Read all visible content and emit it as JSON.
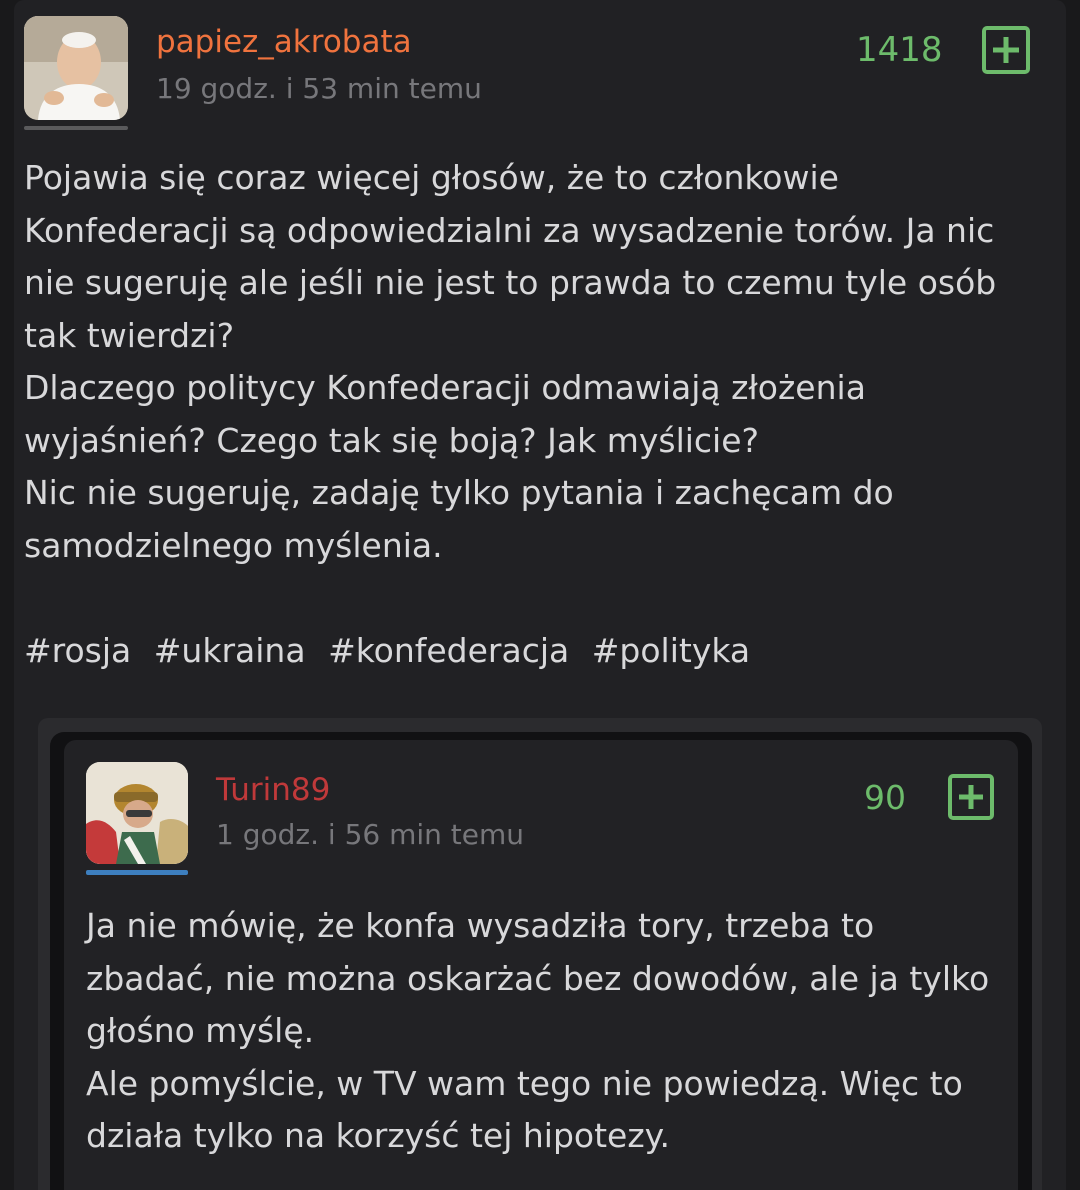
{
  "post": {
    "username": "papiez_akrobata",
    "time": "19 godz. i 53 min temu",
    "votes": "1418",
    "plus_icon": "plus-square-icon",
    "body_lines": [
      "Pojawia się coraz więcej głosów, że to członkowie Konfederacji są odpowiedzialni za wysadzenie torów. Ja nic nie sugeruję ale jeśli nie jest to prawda to czemu tyle osób tak twierdzi?",
      "Dlaczego politycy Konfederacji odmawiają złożenia wyjaśnień? Czego tak się boją? Jak myślicie?",
      "Nic nie sugeruję, zadaję tylko pytania i zachęcam do samodzielnego myślenia."
    ],
    "tags": [
      "#rosja",
      "#ukraina",
      "#konfederacja",
      "#polityka"
    ]
  },
  "reply": {
    "username": "Turin89",
    "time": "1 godz. i 56 min temu",
    "votes": "90",
    "body_lines": [
      "Ja nie mówię, że konfa wysadziła tory, trzeba to zbadać, nie można oskarżać bez dowodów, ale ja tylko głośno myślę.",
      "Ale pomyślcie, w TV wam tego nie powiedzą. Więc to działa tylko na korzyść tej hipotezy."
    ]
  },
  "colors": {
    "username_main": "#f0733e",
    "username_reply": "#c0393a",
    "vote_green": "#6dbb6b"
  }
}
